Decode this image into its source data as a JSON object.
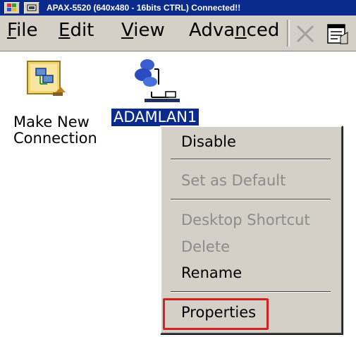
{
  "window": {
    "title": "APAX-5520 (640x480 - 16bits CTRL) Connected!!"
  },
  "menubar": {
    "items": [
      {
        "label_first": "F",
        "label_rest": "ile"
      },
      {
        "label_first": "E",
        "label_rest": "dit"
      },
      {
        "label_first": "V",
        "label_rest": "iew"
      },
      {
        "label_pre": "Adva",
        "label_ul": "n",
        "label_post": "ced"
      }
    ],
    "tools": [
      "delete-icon",
      "properties-icon"
    ]
  },
  "desktop": {
    "icons": [
      {
        "line1": "Make New",
        "line2": "Connection",
        "icon": "make-new-connection-icon",
        "selected": false
      },
      {
        "line1": "ADAMLAN1",
        "icon": "network-connection-icon",
        "selected": true
      }
    ]
  },
  "context_menu": {
    "items": [
      {
        "label": "Disable",
        "enabled": true
      },
      {
        "label": "Set as Default",
        "enabled": false
      },
      {
        "label": "Desktop Shortcut",
        "enabled": false
      },
      {
        "label": "Delete",
        "enabled": false
      },
      {
        "label": "Rename",
        "enabled": true
      },
      {
        "label": "Properties",
        "enabled": true,
        "highlighted": true
      }
    ]
  },
  "colors": {
    "titlebar": "#0a2a8c",
    "menu_face": "#d4d0c8",
    "selection": "#0a2a8c",
    "disabled_text": "#8c8c8c",
    "highlight_border": "#d32222"
  }
}
